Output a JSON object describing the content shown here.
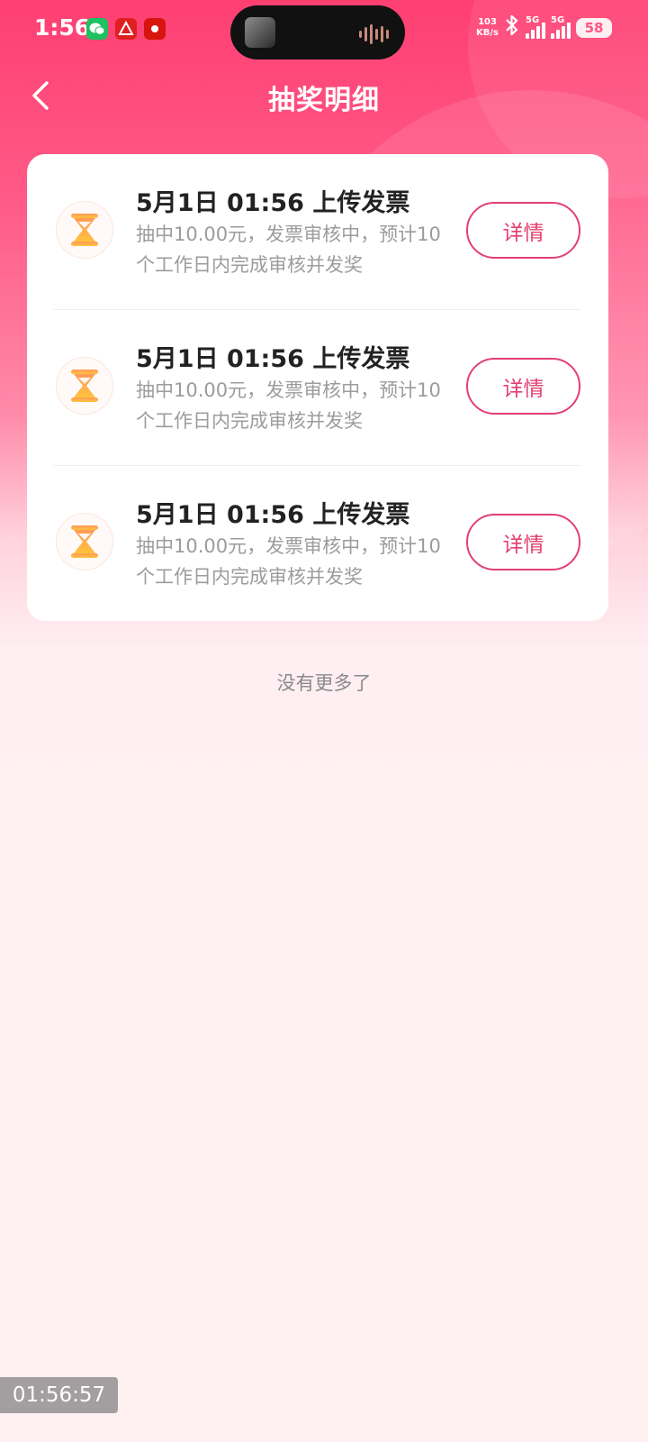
{
  "status_bar": {
    "time": "1:56",
    "net_speed_value": "103",
    "net_speed_unit": "KB/s",
    "signal1_label": "5G",
    "signal2_label": "5G",
    "battery": "58",
    "bluetooth_icon": "bluetooth-icon"
  },
  "header": {
    "title": "抽奖明细",
    "back_icon": "chevron-left-icon"
  },
  "records": [
    {
      "title": "5月1日 01:56 上传发票",
      "description": "抽中10.00元，发票审核中，预计10个工作日内完成审核并发奖",
      "button_label": "详情",
      "icon": "hourglass-icon"
    },
    {
      "title": "5月1日 01:56 上传发票",
      "description": "抽中10.00元，发票审核中，预计10个工作日内完成审核并发奖",
      "button_label": "详情",
      "icon": "hourglass-icon"
    },
    {
      "title": "5月1日 01:56 上传发票",
      "description": "抽中10.00元，发票审核中，预计10个工作日内完成审核并发奖",
      "button_label": "详情",
      "icon": "hourglass-icon"
    }
  ],
  "footer": {
    "no_more_text": "没有更多了"
  },
  "overlay": {
    "recording_timer": "01:56:57"
  },
  "colors": {
    "accent": "#e33f72",
    "header_gradient_top": "#fe3f72",
    "page_background": "#fff0f2"
  }
}
